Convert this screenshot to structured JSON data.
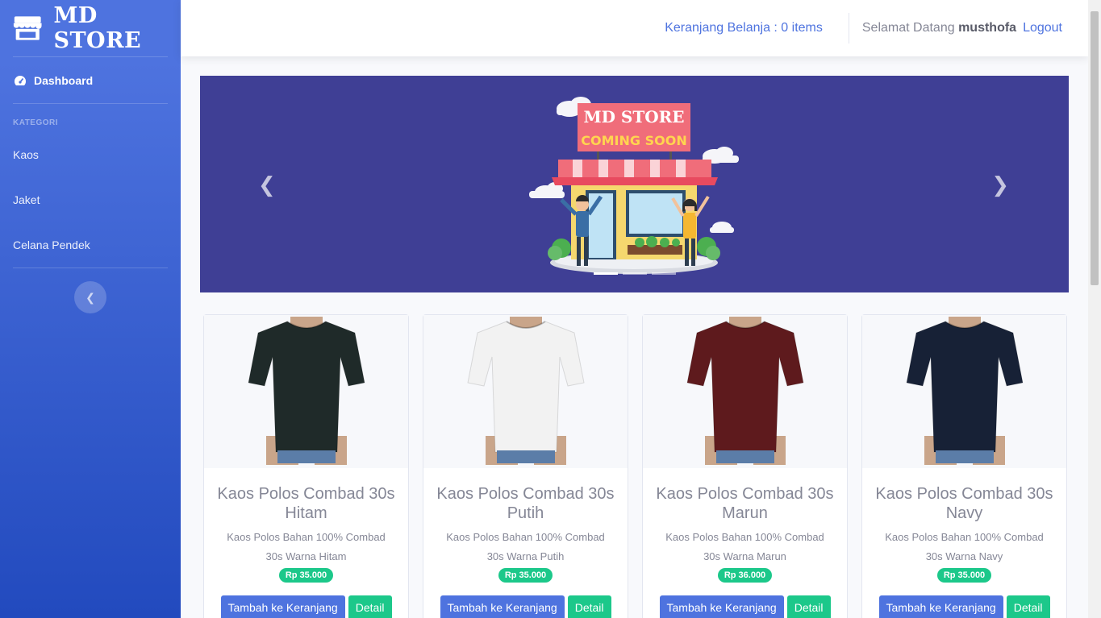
{
  "brand": {
    "name": "MD STORE"
  },
  "sidebar": {
    "dashboard_label": "Dashboard",
    "heading": "KATEGORI",
    "categories": [
      "Kaos",
      "Jaket",
      "Celana Pendek"
    ]
  },
  "topbar": {
    "cart_label": "Keranjang Belanja : 0 items",
    "welcome_prefix": "Selamat Datang",
    "username": "musthofa",
    "logout_label": "Logout"
  },
  "banner": {
    "sign_title": "MD STORE",
    "sign_subtitle": "COMING SOON"
  },
  "products": [
    {
      "name": "Kaos Polos Combad 30s Hitam",
      "desc": "Kaos Polos Bahan 100% Combad 30s Warna Hitam",
      "price": "Rp 35.000",
      "shirt_color": "#1f2a29",
      "add_label": "Tambah ke Keranjang",
      "detail_label": "Detail"
    },
    {
      "name": "Kaos Polos Combad 30s Putih",
      "desc": "Kaos Polos Bahan 100% Combad 30s Warna Putih",
      "price": "Rp 35.000",
      "shirt_color": "#f2f2f2",
      "add_label": "Tambah ke Keranjang",
      "detail_label": "Detail"
    },
    {
      "name": "Kaos Polos Combad 30s Marun",
      "desc": "Kaos Polos Bahan 100% Combad 30s Warna Marun",
      "price": "Rp 36.000",
      "shirt_color": "#5e1a1d",
      "add_label": "Tambah ke Keranjang",
      "detail_label": "Detail"
    },
    {
      "name": "Kaos Polos Combad 30s Navy",
      "desc": "Kaos Polos Bahan 100% Combad 30s Warna Navy",
      "price": "Rp 35.000",
      "shirt_color": "#172136",
      "add_label": "Tambah ke Keranjang",
      "detail_label": "Detail"
    }
  ],
  "colors": {
    "primary": "#4e73df",
    "success": "#1cc88a",
    "banner_bg": "#3f3f95"
  }
}
